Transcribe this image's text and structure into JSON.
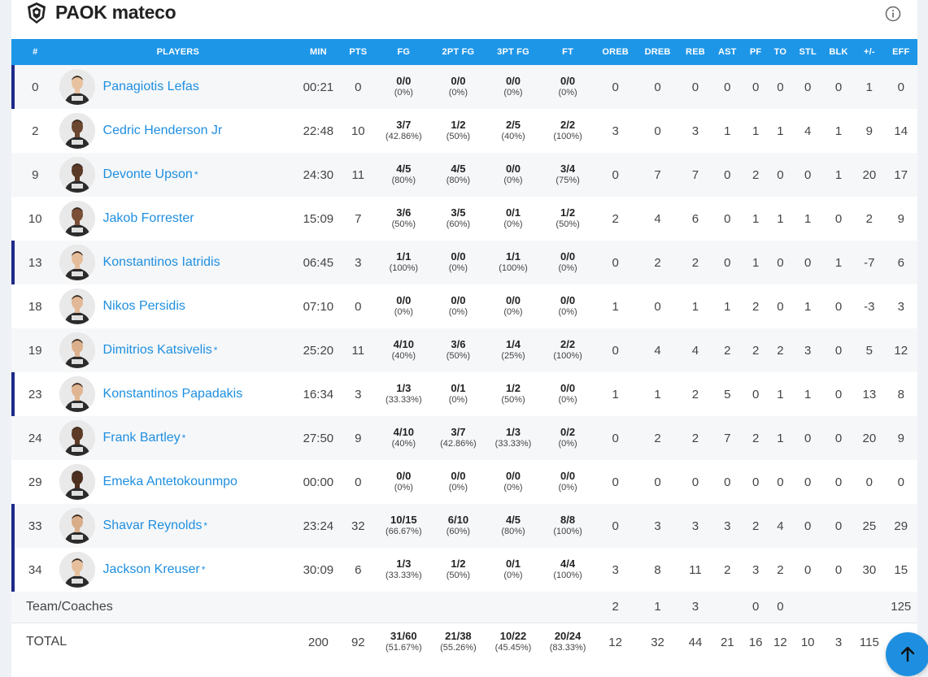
{
  "header": {
    "team_name": "PAOK mateco"
  },
  "columns": [
    "#",
    "PLAYERS",
    "MIN",
    "PTS",
    "FG",
    "2PT FG",
    "3PT FG",
    "FT",
    "OREB",
    "DREB",
    "REB",
    "AST",
    "PF",
    "TO",
    "STL",
    "BLK",
    "+/-",
    "EFF"
  ],
  "players": [
    {
      "num": "0",
      "name": "Panagiotis Lefas",
      "star": "",
      "min": "00:21",
      "pts": "0",
      "fg": "0/0",
      "fg_pct": "(0%)",
      "fg2": "0/0",
      "fg2_pct": "(0%)",
      "fg3": "0/0",
      "fg3_pct": "(0%)",
      "ft": "0/0",
      "ft_pct": "(0%)",
      "oreb": "0",
      "dreb": "0",
      "reb": "0",
      "ast": "0",
      "pf": "0",
      "to": "0",
      "stl": "0",
      "blk": "0",
      "pm": "1",
      "eff": "0",
      "starter": true
    },
    {
      "num": "2",
      "name": "Cedric Henderson Jr",
      "star": "",
      "min": "22:48",
      "pts": "10",
      "fg": "3/7",
      "fg_pct": "(42.86%)",
      "fg2": "1/2",
      "fg2_pct": "(50%)",
      "fg3": "2/5",
      "fg3_pct": "(40%)",
      "ft": "2/2",
      "ft_pct": "(100%)",
      "oreb": "3",
      "dreb": "0",
      "reb": "3",
      "ast": "1",
      "pf": "1",
      "to": "1",
      "stl": "4",
      "blk": "1",
      "pm": "9",
      "eff": "14",
      "starter": false
    },
    {
      "num": "9",
      "name": "Devonte Upson",
      "star": "*",
      "min": "24:30",
      "pts": "11",
      "fg": "4/5",
      "fg_pct": "(80%)",
      "fg2": "4/5",
      "fg2_pct": "(80%)",
      "fg3": "0/0",
      "fg3_pct": "(0%)",
      "ft": "3/4",
      "ft_pct": "(75%)",
      "oreb": "0",
      "dreb": "7",
      "reb": "7",
      "ast": "0",
      "pf": "2",
      "to": "0",
      "stl": "0",
      "blk": "1",
      "pm": "20",
      "eff": "17",
      "starter": false
    },
    {
      "num": "10",
      "name": "Jakob Forrester",
      "star": "",
      "min": "15:09",
      "pts": "7",
      "fg": "3/6",
      "fg_pct": "(50%)",
      "fg2": "3/5",
      "fg2_pct": "(60%)",
      "fg3": "0/1",
      "fg3_pct": "(0%)",
      "ft": "1/2",
      "ft_pct": "(50%)",
      "oreb": "2",
      "dreb": "4",
      "reb": "6",
      "ast": "0",
      "pf": "1",
      "to": "1",
      "stl": "1",
      "blk": "0",
      "pm": "2",
      "eff": "9",
      "starter": false
    },
    {
      "num": "13",
      "name": "Konstantinos Iatridis",
      "star": "",
      "min": "06:45",
      "pts": "3",
      "fg": "1/1",
      "fg_pct": "(100%)",
      "fg2": "0/0",
      "fg2_pct": "(0%)",
      "fg3": "1/1",
      "fg3_pct": "(100%)",
      "ft": "0/0",
      "ft_pct": "(0%)",
      "oreb": "0",
      "dreb": "2",
      "reb": "2",
      "ast": "0",
      "pf": "1",
      "to": "0",
      "stl": "0",
      "blk": "1",
      "pm": "-7",
      "eff": "6",
      "starter": true
    },
    {
      "num": "18",
      "name": "Nikos Persidis",
      "star": "",
      "min": "07:10",
      "pts": "0",
      "fg": "0/0",
      "fg_pct": "(0%)",
      "fg2": "0/0",
      "fg2_pct": "(0%)",
      "fg3": "0/0",
      "fg3_pct": "(0%)",
      "ft": "0/0",
      "ft_pct": "(0%)",
      "oreb": "1",
      "dreb": "0",
      "reb": "1",
      "ast": "1",
      "pf": "2",
      "to": "0",
      "stl": "1",
      "blk": "0",
      "pm": "-3",
      "eff": "3",
      "starter": false
    },
    {
      "num": "19",
      "name": "Dimitrios Katsivelis",
      "star": "*",
      "min": "25:20",
      "pts": "11",
      "fg": "4/10",
      "fg_pct": "(40%)",
      "fg2": "3/6",
      "fg2_pct": "(50%)",
      "fg3": "1/4",
      "fg3_pct": "(25%)",
      "ft": "2/2",
      "ft_pct": "(100%)",
      "oreb": "0",
      "dreb": "4",
      "reb": "4",
      "ast": "2",
      "pf": "2",
      "to": "2",
      "stl": "3",
      "blk": "0",
      "pm": "5",
      "eff": "12",
      "starter": false
    },
    {
      "num": "23",
      "name": "Konstantinos Papadakis",
      "star": "",
      "min": "16:34",
      "pts": "3",
      "fg": "1/3",
      "fg_pct": "(33.33%)",
      "fg2": "0/1",
      "fg2_pct": "(0%)",
      "fg3": "1/2",
      "fg3_pct": "(50%)",
      "ft": "0/0",
      "ft_pct": "(0%)",
      "oreb": "1",
      "dreb": "1",
      "reb": "2",
      "ast": "5",
      "pf": "0",
      "to": "1",
      "stl": "1",
      "blk": "0",
      "pm": "13",
      "eff": "8",
      "starter": true
    },
    {
      "num": "24",
      "name": "Frank Bartley",
      "star": "*",
      "min": "27:50",
      "pts": "9",
      "fg": "4/10",
      "fg_pct": "(40%)",
      "fg2": "3/7",
      "fg2_pct": "(42.86%)",
      "fg3": "1/3",
      "fg3_pct": "(33.33%)",
      "ft": "0/2",
      "ft_pct": "(0%)",
      "oreb": "0",
      "dreb": "2",
      "reb": "2",
      "ast": "7",
      "pf": "2",
      "to": "1",
      "stl": "0",
      "blk": "0",
      "pm": "20",
      "eff": "9",
      "starter": false
    },
    {
      "num": "29",
      "name": "Emeka Antetokounmpo",
      "star": "",
      "min": "00:00",
      "pts": "0",
      "fg": "0/0",
      "fg_pct": "(0%)",
      "fg2": "0/0",
      "fg2_pct": "(0%)",
      "fg3": "0/0",
      "fg3_pct": "(0%)",
      "ft": "0/0",
      "ft_pct": "(0%)",
      "oreb": "0",
      "dreb": "0",
      "reb": "0",
      "ast": "0",
      "pf": "0",
      "to": "0",
      "stl": "0",
      "blk": "0",
      "pm": "0",
      "eff": "0",
      "starter": false
    },
    {
      "num": "33",
      "name": "Shavar Reynolds",
      "star": "*",
      "min": "23:24",
      "pts": "32",
      "fg": "10/15",
      "fg_pct": "(66.67%)",
      "fg2": "6/10",
      "fg2_pct": "(60%)",
      "fg3": "4/5",
      "fg3_pct": "(80%)",
      "ft": "8/8",
      "ft_pct": "(100%)",
      "oreb": "0",
      "dreb": "3",
      "reb": "3",
      "ast": "3",
      "pf": "2",
      "to": "4",
      "stl": "0",
      "blk": "0",
      "pm": "25",
      "eff": "29",
      "starter": true
    },
    {
      "num": "34",
      "name": "Jackson Kreuser",
      "star": "*",
      "min": "30:09",
      "pts": "6",
      "fg": "1/3",
      "fg_pct": "(33.33%)",
      "fg2": "1/2",
      "fg2_pct": "(50%)",
      "fg3": "0/1",
      "fg3_pct": "(0%)",
      "ft": "4/4",
      "ft_pct": "(100%)",
      "oreb": "3",
      "dreb": "8",
      "reb": "11",
      "ast": "2",
      "pf": "3",
      "to": "2",
      "stl": "0",
      "blk": "0",
      "pm": "30",
      "eff": "15",
      "starter": true
    }
  ],
  "team_coaches": {
    "label": "Team/Coaches",
    "oreb": "2",
    "dreb": "1",
    "reb": "3",
    "pf": "0",
    "to": "0",
    "eff": "125"
  },
  "total": {
    "label": "TOTAL",
    "min": "200",
    "pts": "92",
    "fg": "31/60",
    "fg_pct": "(51.67%)",
    "fg2": "21/38",
    "fg2_pct": "(55.26%)",
    "fg3": "10/22",
    "fg3_pct": "(45.45%)",
    "ft": "20/24",
    "ft_pct": "(83.33%)",
    "oreb": "12",
    "dreb": "32",
    "reb": "44",
    "ast": "21",
    "pf": "16",
    "to": "12",
    "stl": "10",
    "blk": "3",
    "pm": "115"
  },
  "colors": {
    "header_bg": "#1e96e8",
    "link": "#1e8fe0",
    "starter_bar": "#1e2a8a"
  }
}
